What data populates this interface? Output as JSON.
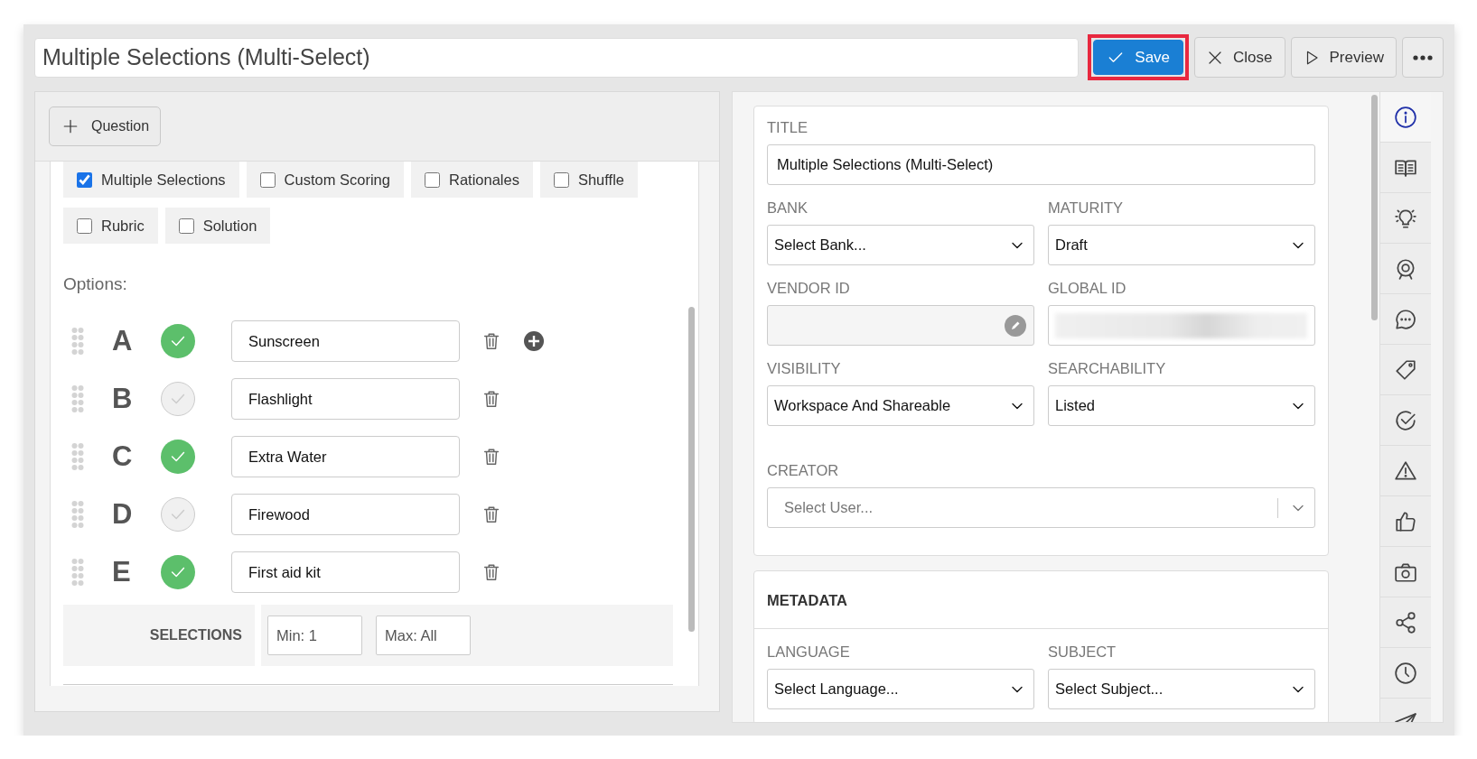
{
  "toolbar": {
    "title_value": "Multiple Selections (Multi-Select)",
    "buttons": [
      {
        "kind": "save",
        "label": "Save",
        "highlighted": true
      },
      {
        "kind": "close",
        "label": "Close",
        "highlighted": false
      },
      {
        "kind": "preview",
        "label": "Preview",
        "highlighted": false
      },
      {
        "kind": "more",
        "highlighted": false
      }
    ]
  },
  "editor": {
    "add_button": "Question",
    "toggles": [
      {
        "label": "Multiple Selections",
        "checked": true
      },
      {
        "label": "Custom Scoring",
        "checked": false
      },
      {
        "label": "Rationales",
        "checked": false
      },
      {
        "label": "Shuffle",
        "checked": false
      },
      {
        "label": "Rubric",
        "checked": false
      },
      {
        "label": "Solution",
        "checked": false
      }
    ],
    "options_label": "Options:",
    "options": [
      {
        "letter": "A",
        "text": "Sunscreen",
        "correct": true,
        "add_button": true
      },
      {
        "letter": "B",
        "text": "Flashlight",
        "correct": false,
        "add_button": false
      },
      {
        "letter": "C",
        "text": "Extra Water",
        "correct": true,
        "add_button": false
      },
      {
        "letter": "D",
        "text": "Firewood",
        "correct": false,
        "add_button": false
      },
      {
        "letter": "E",
        "text": "First aid kit",
        "correct": true,
        "add_button": false
      }
    ],
    "selections": {
      "label": "SELECTIONS",
      "min_placeholder": "Min: 1",
      "max_placeholder": "Max: All"
    }
  },
  "details": {
    "fields": [
      {
        "kind": "text",
        "label": "TITLE",
        "value": "Multiple Selections (Multi-Select)"
      },
      {
        "kind": "select",
        "label": "BANK",
        "value": "Select Bank..."
      },
      {
        "kind": "select",
        "label": "MATURITY",
        "value": "Draft"
      },
      {
        "kind": "locked",
        "label": "VENDOR ID"
      },
      {
        "kind": "redacted",
        "label": "GLOBAL ID"
      },
      {
        "kind": "select",
        "label": "VISIBILITY",
        "value": "Workspace And Shareable"
      },
      {
        "kind": "select",
        "label": "SEARCHABILITY",
        "value": "Listed"
      },
      {
        "kind": "combo",
        "label": "CREATOR",
        "placeholder": "Select User..."
      }
    ]
  },
  "metadata": {
    "heading": "METADATA",
    "fields": [
      {
        "kind": "select",
        "label": "LANGUAGE",
        "value": "Select Language..."
      },
      {
        "kind": "select",
        "label": "SUBJECT",
        "value": "Select Subject..."
      }
    ]
  },
  "rail": [
    {
      "kind": "info",
      "selected": true
    },
    {
      "kind": "book",
      "selected": false
    },
    {
      "kind": "bulb",
      "selected": false
    },
    {
      "kind": "target",
      "selected": false
    },
    {
      "kind": "chat",
      "selected": false
    },
    {
      "kind": "tag",
      "selected": false
    },
    {
      "kind": "check",
      "selected": false
    },
    {
      "kind": "warning",
      "selected": false
    },
    {
      "kind": "thumb",
      "selected": false
    },
    {
      "kind": "camera",
      "selected": false
    },
    {
      "kind": "share",
      "selected": false
    },
    {
      "kind": "clock",
      "selected": false
    },
    {
      "kind": "send",
      "selected": false
    }
  ]
}
